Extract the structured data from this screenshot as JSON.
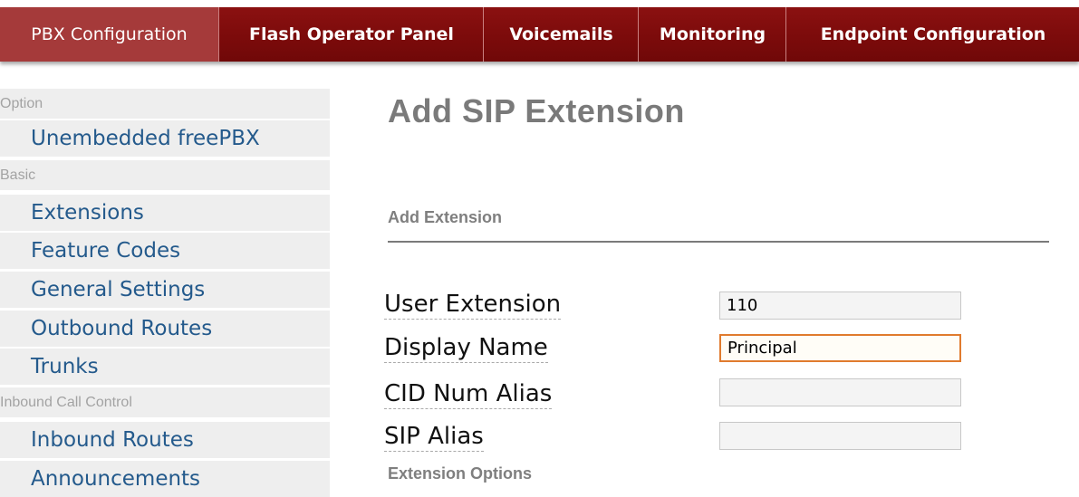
{
  "nav": {
    "tabs": [
      {
        "label": "PBX Configuration",
        "active": true
      },
      {
        "label": "Flash Operator Panel",
        "active": false
      },
      {
        "label": "Voicemails",
        "active": false
      },
      {
        "label": "Monitoring",
        "active": false
      },
      {
        "label": "Endpoint Configuration",
        "active": false
      }
    ]
  },
  "sidebar": {
    "categories": {
      "option": "Option",
      "basic": "Basic",
      "inbound": "Inbound Call Control"
    },
    "items": {
      "unembedded": "Unembedded freePBX",
      "extensions": "Extensions",
      "feature_codes": "Feature Codes",
      "general_settings": "General Settings",
      "outbound_routes": "Outbound Routes",
      "trunks": "Trunks",
      "inbound_routes": "Inbound Routes",
      "announcements": "Announcements"
    }
  },
  "main": {
    "title": "Add SIP Extension",
    "section": "Add Extension",
    "fields": [
      {
        "label": "User Extension",
        "value": "110"
      },
      {
        "label": "Display Name",
        "value": "Principal"
      },
      {
        "label": "CID Num Alias",
        "value": ""
      },
      {
        "label": "SIP Alias",
        "value": ""
      }
    ],
    "options_heading": "Extension Options"
  },
  "colors": {
    "nav_bg": "#7c0b0b",
    "nav_active": "#a53a3a",
    "link": "#245a8c",
    "focus_border": "#e07b2e"
  }
}
